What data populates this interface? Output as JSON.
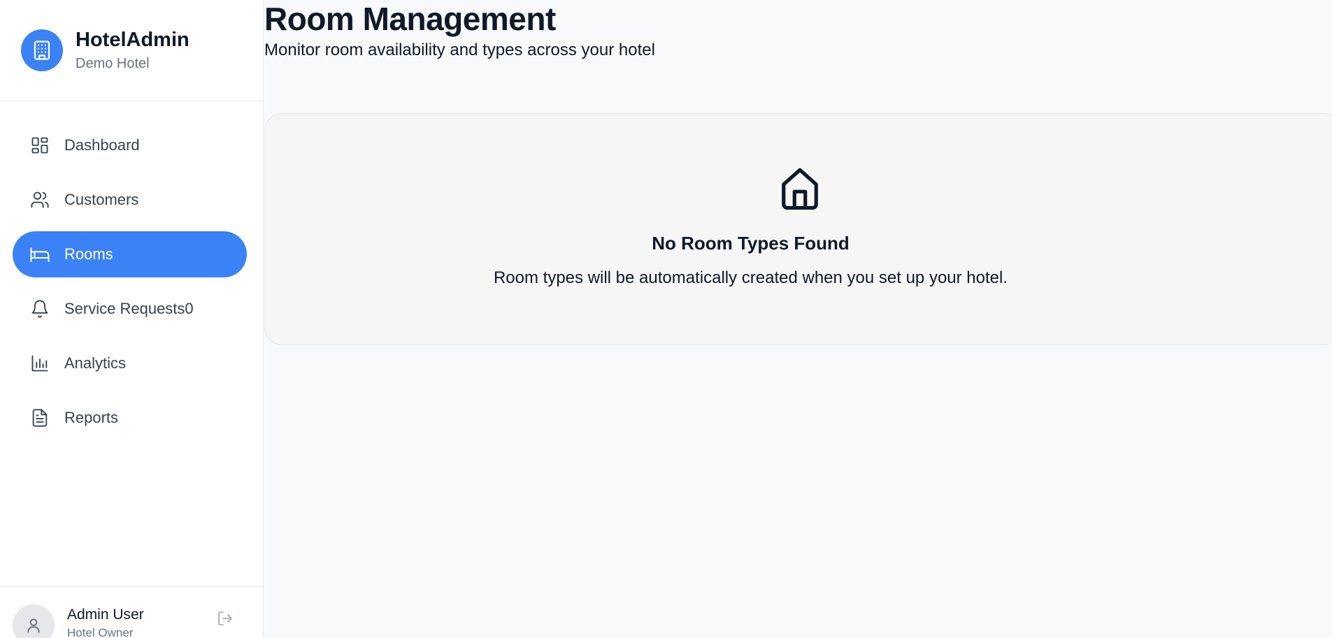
{
  "brand": {
    "title": "HotelAdmin",
    "subtitle": "Demo Hotel",
    "icon": "hotel-building-icon"
  },
  "nav": {
    "items": [
      {
        "label": "Dashboard",
        "icon": "dashboard-icon",
        "active": false
      },
      {
        "label": "Customers",
        "icon": "users-icon",
        "active": false
      },
      {
        "label": "Rooms",
        "icon": "bed-icon",
        "active": true
      },
      {
        "label": "Service Requests0",
        "icon": "bell-icon",
        "active": false
      },
      {
        "label": "Analytics",
        "icon": "bar-chart-icon",
        "active": false
      },
      {
        "label": "Reports",
        "icon": "document-icon",
        "active": false
      }
    ]
  },
  "user": {
    "name": "Admin User",
    "role": "Hotel Owner"
  },
  "page": {
    "title": "Room Management",
    "subtitle": "Monitor room availability and types across your hotel"
  },
  "empty_state": {
    "icon": "house-icon",
    "title": "No Room Types Found",
    "description": "Room types will be automatically created when you set up your hotel."
  },
  "colors": {
    "accent": "#3b82f6",
    "background": "#f8f9fb",
    "sidebar": "#ffffff",
    "text_muted": "#6b7280"
  }
}
